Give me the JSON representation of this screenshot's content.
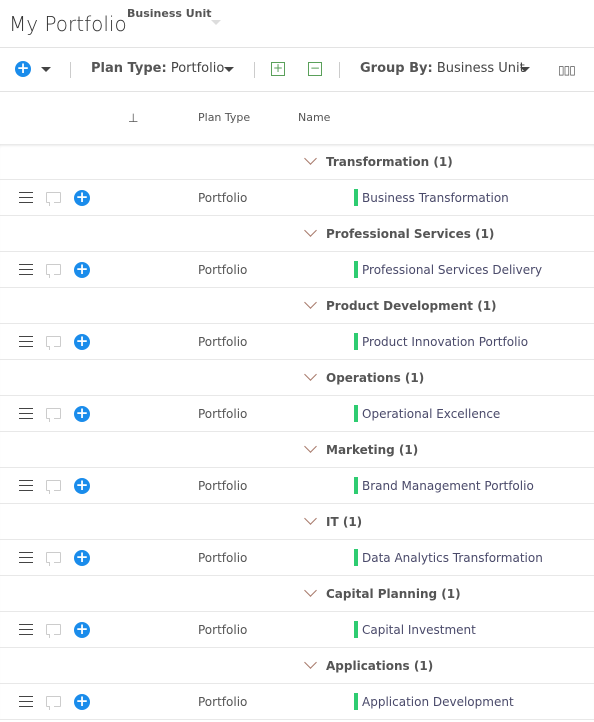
{
  "header": {
    "title": "My Portfolio",
    "business_unit_label": "Business Unit"
  },
  "toolbar": {
    "plan_type_label": "Plan Type:",
    "plan_type_value": "Portfolio",
    "group_by_label": "Group By:",
    "group_by_value": "Business Unit"
  },
  "columns": {
    "plan_type": "Plan Type",
    "name": "Name"
  },
  "accent": "#1a8ceb",
  "status_color": "#2ecc71",
  "groups": [
    {
      "label": "Transformation (1)",
      "plan_type": "Portfolio",
      "item": "Business Transformation"
    },
    {
      "label": "Professional Services (1)",
      "plan_type": "Portfolio",
      "item": "Professional Services Delivery"
    },
    {
      "label": "Product Development (1)",
      "plan_type": "Portfolio",
      "item": "Product Innovation Portfolio"
    },
    {
      "label": "Operations (1)",
      "plan_type": "Portfolio",
      "item": "Operational Excellence"
    },
    {
      "label": "Marketing (1)",
      "plan_type": "Portfolio",
      "item": "Brand Management Portfolio"
    },
    {
      "label": "IT (1)",
      "plan_type": "Portfolio",
      "item": "Data Analytics Transformation"
    },
    {
      "label": "Capital Planning (1)",
      "plan_type": "Portfolio",
      "item": "Capital Investment"
    },
    {
      "label": "Applications (1)",
      "plan_type": "Portfolio",
      "item": "Application Development"
    }
  ]
}
